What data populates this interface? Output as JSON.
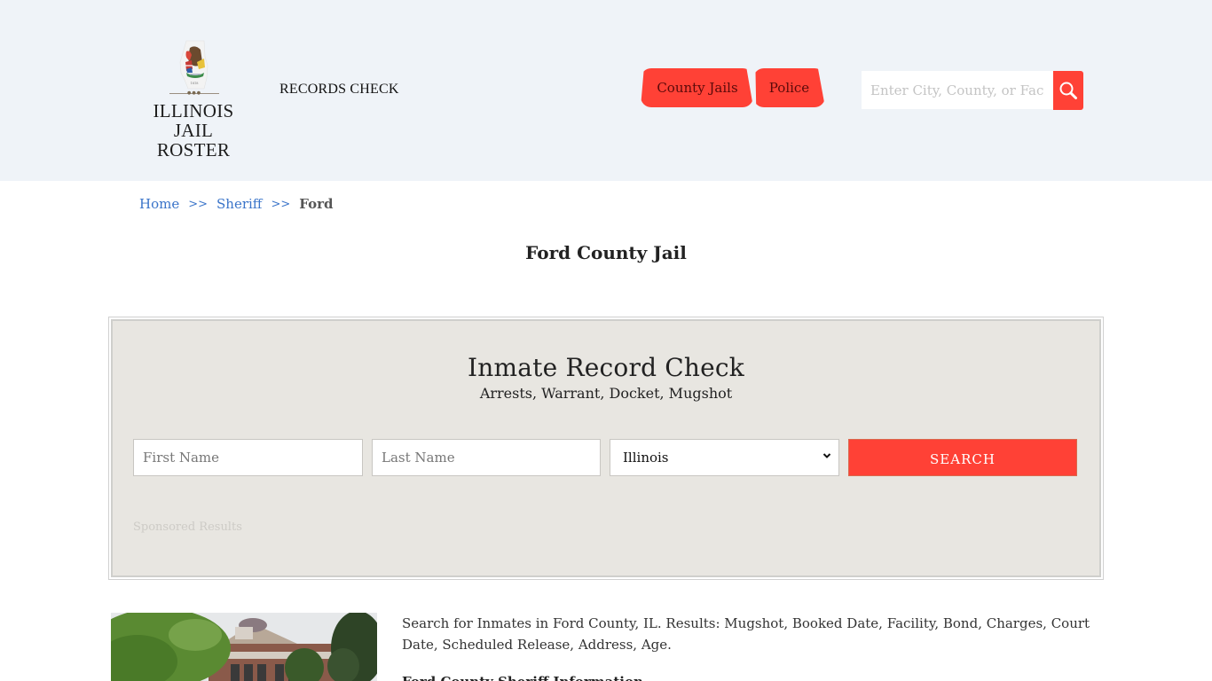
{
  "header": {
    "logo": {
      "line1": "ILLINOIS",
      "line2": "JAIL ROSTER",
      "seal_icon": "illinois-state-seal"
    },
    "records_link": "RECORDS CHECK",
    "nav": [
      {
        "label": "County Jails"
      },
      {
        "label": "Police"
      }
    ],
    "search": {
      "placeholder": "Enter City, County, or Facility",
      "icon": "search-icon"
    }
  },
  "breadcrumb": {
    "items": [
      {
        "label": "Home"
      },
      {
        "label": "Sheriff"
      }
    ],
    "separator": ">>",
    "current": "Ford"
  },
  "page": {
    "title": "Ford County Jail"
  },
  "record_check": {
    "title": "Inmate Record Check",
    "subtitle": "Arrests, Warrant, Docket, Mugshot",
    "first_name_placeholder": "First Name",
    "last_name_placeholder": "Last Name",
    "state_selected": "Illinois",
    "submit_label": "SEARCH",
    "sponsored_label": "Sponsored Results"
  },
  "content": {
    "intro": "Search for Inmates in Ford County, IL. Results: Mugshot, Booked Date, Facility, Bond, Charges, Court Date, Scheduled Release, Address, Age.",
    "info_heading": "Ford County Sheriff Information",
    "photo_alt": "Ford County courthouse building"
  },
  "colors": {
    "accent": "#ff4136",
    "header_bg": "#eff3f8",
    "panel_bg": "#e8e6e1",
    "link": "#3a74c9"
  }
}
